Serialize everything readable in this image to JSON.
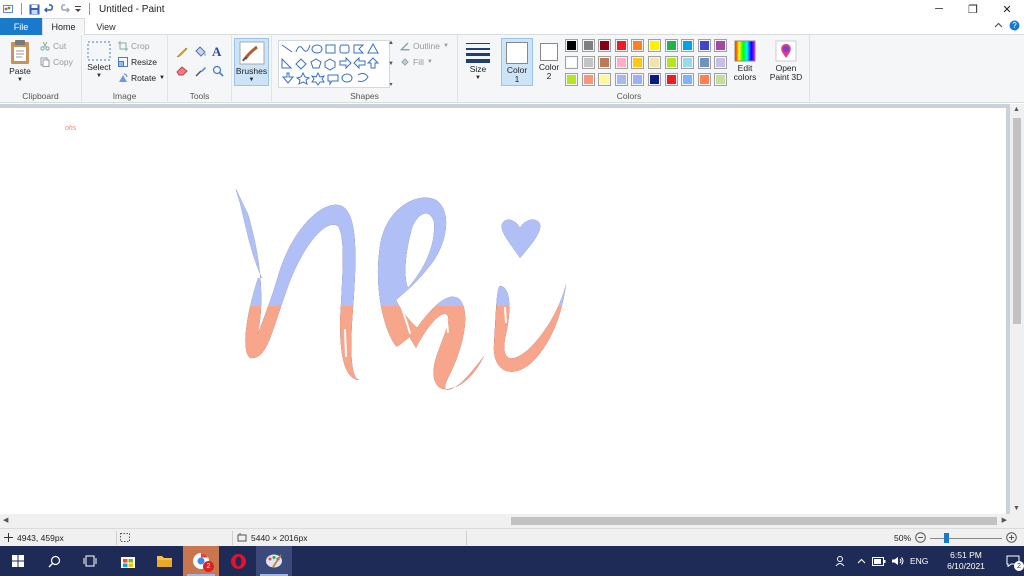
{
  "window": {
    "title": "Untitled - Paint",
    "minimize_icon": "minimize-icon",
    "restore_icon": "restore-icon",
    "close_icon": "close-icon"
  },
  "tabs": [
    {
      "label": "File",
      "active": false
    },
    {
      "label": "Home",
      "active": true
    },
    {
      "label": "View",
      "active": false
    }
  ],
  "ribbon": {
    "clipboard": {
      "label": "Clipboard",
      "paste": "Paste",
      "cut": "Cut",
      "copy": "Copy"
    },
    "image": {
      "label": "Image",
      "select": "Select",
      "crop": "Crop",
      "resize": "Resize",
      "rotate": "Rotate"
    },
    "tools": {
      "label": "Tools"
    },
    "brushes": {
      "label": "Brushes"
    },
    "shapes": {
      "label": "Shapes",
      "outline": "Outline",
      "fill": "Fill"
    },
    "size": {
      "label": "Size"
    },
    "colors": {
      "label": "Colors",
      "color1": "Color",
      "color1_num": "1",
      "color2": "Color",
      "color2_num": "2",
      "edit_colors_line1": "Edit",
      "edit_colors_line2": "colors",
      "open3d_line1": "Open",
      "open3d_line2": "Paint 3D",
      "palette": [
        "#000000",
        "#7f7f7f",
        "#880015",
        "#ed1c24",
        "#ff7f27",
        "#fff200",
        "#22b14c",
        "#00a2e8",
        "#3f48cc",
        "#a349a4",
        "#ffffff",
        "#c3c3c3",
        "#b97a57",
        "#ffaec9",
        "#ffc90e",
        "#efe4b0",
        "#b5e61d",
        "#99d9ea",
        "#7092be",
        "#c8bfe7",
        "#b5e61d",
        "#f7977a",
        "#fff799",
        "#a8b8f0",
        "#9fb1f5",
        "#0b1a80",
        "#ed1c24",
        "#7fb2ff",
        "#ff7f50",
        "#c4df9b"
      ]
    }
  },
  "canvas": {
    "drawing_colors": {
      "top": "#b0bff5",
      "bottom": "#f7a58b"
    },
    "tiny_text": "ohs"
  },
  "status": {
    "cursor_pos": "4943, 459px",
    "image_size": "5440 × 2016px",
    "zoom": "50%",
    "zoom_level": 0.5
  },
  "taskbar": {
    "language": "ENG",
    "time": "6:51 PM",
    "date": "6/10/2021",
    "notification_count": "2",
    "chrome_badge": "2"
  }
}
